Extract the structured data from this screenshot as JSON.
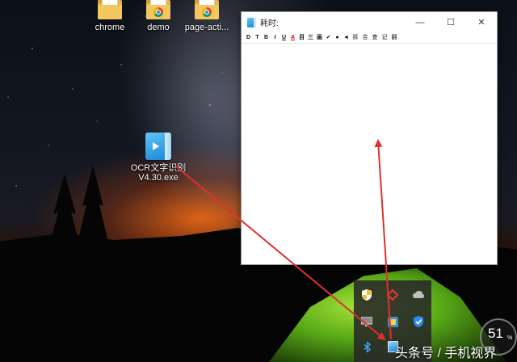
{
  "desktop": {
    "icons": [
      {
        "label": "chrome",
        "type": "folder"
      },
      {
        "label": "demo",
        "type": "folder"
      },
      {
        "label": "page-acti...",
        "type": "folder"
      },
      {
        "label": "OCR文字识别V4.30.exe",
        "type": "exe"
      }
    ]
  },
  "window": {
    "title": "耗时:",
    "toolbar": [
      "D",
      "T",
      "B",
      "I",
      "U",
      "A",
      "目",
      "三",
      "画",
      "✔",
      "●",
      "◄",
      "拆",
      "合",
      "查",
      "记",
      "翻"
    ],
    "controls": {
      "minimize": "—",
      "maximize": "☐",
      "close": "✕"
    }
  },
  "tray": {
    "icons": [
      "shield-warning-icon",
      "link-icon",
      "cloud-icon",
      "monitor-icon",
      "app-icon",
      "shield-icon",
      "bluetooth-icon",
      "ocr-app-icon"
    ]
  },
  "gauge": {
    "value": "51",
    "unit": "%"
  },
  "watermark": "头条号 / 手机视界",
  "colors": {
    "arrow": "#e03030",
    "tent": "#8be02a"
  }
}
